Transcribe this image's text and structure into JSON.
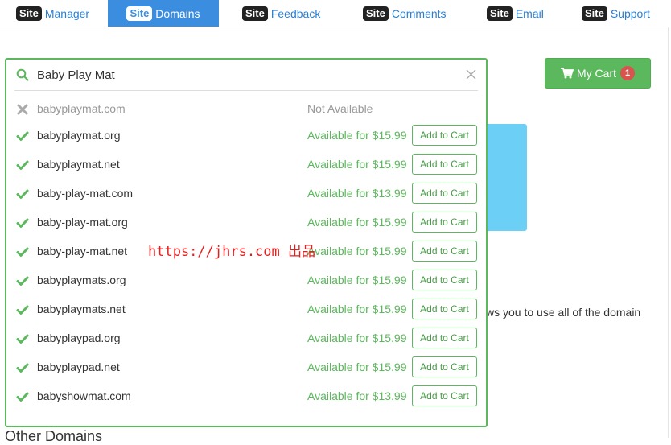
{
  "nav": {
    "badge": "Site",
    "items": [
      {
        "label": "Manager",
        "active": false
      },
      {
        "label": "Domains",
        "active": true
      },
      {
        "label": "Feedback",
        "active": false
      },
      {
        "label": "Comments",
        "active": false
      },
      {
        "label": "Email",
        "active": false
      },
      {
        "label": "Support",
        "active": false
      }
    ]
  },
  "cart": {
    "label": "My Cart",
    "count": "1",
    "icon": "shopping-cart-icon"
  },
  "search": {
    "value": "Baby Play Mat",
    "icon": "search-icon",
    "clear_icon": "close-icon"
  },
  "results": [
    {
      "domain": "babyplaymat.com",
      "status": "Not Available",
      "available": false
    },
    {
      "domain": "babyplaymat.org",
      "status": "Available for $15.99",
      "available": true,
      "button": "Add to Cart"
    },
    {
      "domain": "babyplaymat.net",
      "status": "Available for $15.99",
      "available": true,
      "button": "Add to Cart"
    },
    {
      "domain": "baby-play-mat.com",
      "status": "Available for $13.99",
      "available": true,
      "button": "Add to Cart"
    },
    {
      "domain": "baby-play-mat.org",
      "status": "Available for $15.99",
      "available": true,
      "button": "Add to Cart"
    },
    {
      "domain": "baby-play-mat.net",
      "status": "Available for $15.99",
      "available": true,
      "button": "Add to Cart"
    },
    {
      "domain": "babyplaymats.org",
      "status": "Available for $15.99",
      "available": true,
      "button": "Add to Cart"
    },
    {
      "domain": "babyplaymats.net",
      "status": "Available for $15.99",
      "available": true,
      "button": "Add to Cart"
    },
    {
      "domain": "babyplaypad.org",
      "status": "Available for $15.99",
      "available": true,
      "button": "Add to Cart"
    },
    {
      "domain": "babyplaypad.net",
      "status": "Available for $15.99",
      "available": true,
      "button": "Add to Cart"
    },
    {
      "domain": "babyshowmat.com",
      "status": "Available for $13.99",
      "available": true,
      "button": "Add to Cart"
    }
  ],
  "watermark": "https://jhrs.com 出品",
  "background": {
    "partial_text": "ws you to use all of the domain",
    "other_heading": "Other Domains"
  },
  "colors": {
    "primary": "#3b8de0",
    "success": "#5cb85c",
    "danger": "#d9534f",
    "info_box": "#6ccff6"
  }
}
